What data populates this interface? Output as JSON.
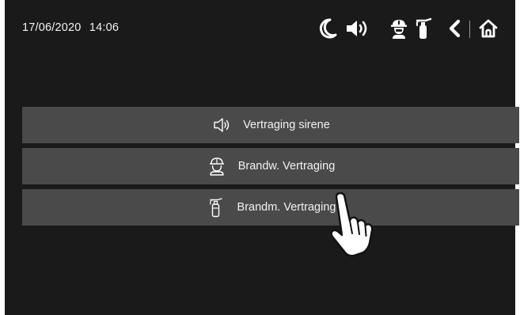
{
  "status_bar": {
    "date": "17/06/2020",
    "time": "14:06",
    "icons": [
      "moon-icon",
      "speaker-icon",
      "fireman-icon",
      "fire-extinguisher-icon",
      "back-icon",
      "home-icon"
    ]
  },
  "menu": {
    "items": [
      {
        "label": "Vertraging sirene",
        "icon": "speaker-icon"
      },
      {
        "label": "Brandw. Vertraging",
        "icon": "fireman-icon"
      },
      {
        "label": "Brandm. Vertraging",
        "icon": "fire-extinguisher-icon"
      }
    ]
  },
  "colors": {
    "background": "#1a1a1a",
    "menu_item": "#4a4a4a",
    "text": "#f2f2f2"
  }
}
